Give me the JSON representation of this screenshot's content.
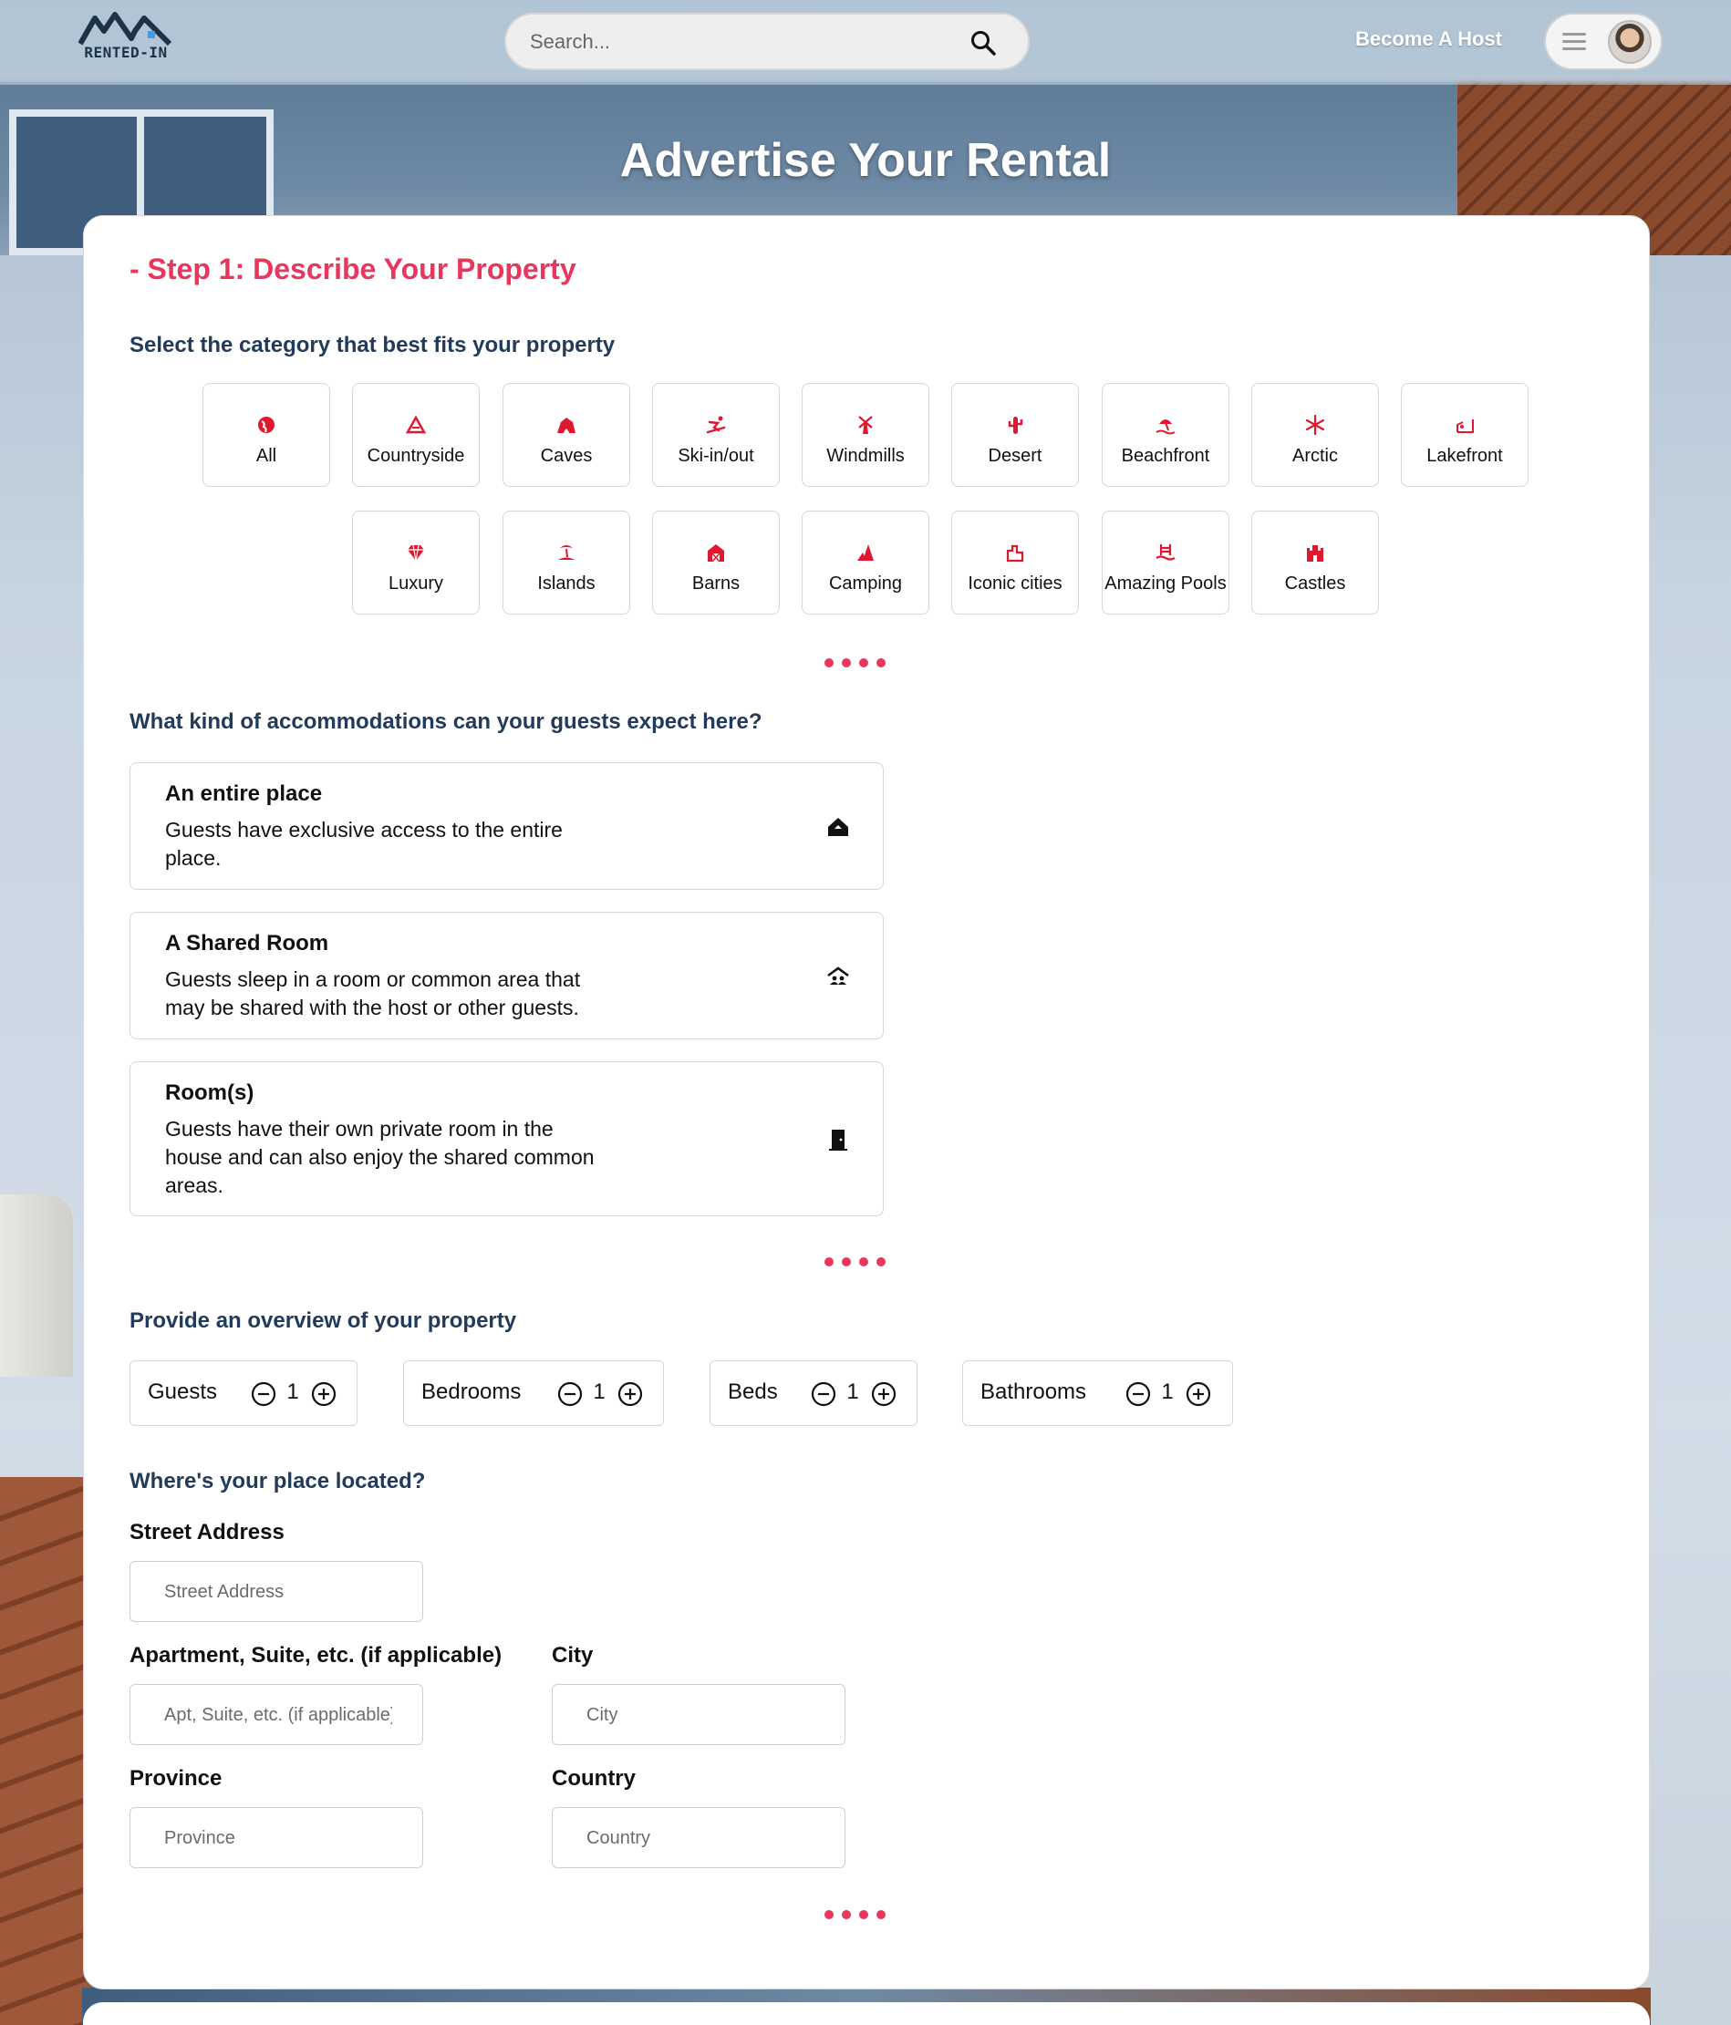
{
  "header": {
    "logo_text": "RENTED-IN",
    "search_placeholder": "Search...",
    "become_host_label": "Become A Host"
  },
  "hero": {
    "title": "Advertise Your Rental"
  },
  "form": {
    "step_title": "- Step 1: Describe Your Property",
    "category_question": "Select the category that best fits your property",
    "categories": [
      {
        "label": "All",
        "icon": "globe-icon"
      },
      {
        "label": "Countryside",
        "icon": "mountain-icon"
      },
      {
        "label": "Caves",
        "icon": "cave-icon"
      },
      {
        "label": "Ski-in/out",
        "icon": "skier-icon"
      },
      {
        "label": "Windmills",
        "icon": "windmill-icon"
      },
      {
        "label": "Desert",
        "icon": "cactus-icon"
      },
      {
        "label": "Beachfront",
        "icon": "beach-icon"
      },
      {
        "label": "Arctic",
        "icon": "snowflake-icon"
      },
      {
        "label": "Lakefront",
        "icon": "fishing-icon"
      },
      {
        "label": "Luxury",
        "icon": "diamond-icon"
      },
      {
        "label": "Islands",
        "icon": "island-icon"
      },
      {
        "label": "Barns",
        "icon": "barn-icon"
      },
      {
        "label": "Camping",
        "icon": "tent-icon"
      },
      {
        "label": "Iconic cities",
        "icon": "city-icon"
      },
      {
        "label": "Amazing Pools",
        "icon": "pool-icon"
      },
      {
        "label": "Castles",
        "icon": "castle-icon"
      }
    ],
    "accommodation_question": "What kind of accommodations can your guests expect here?",
    "accommodations": [
      {
        "title": "An entire place",
        "description": "Guests have exclusive access to the entire place.",
        "icon": "house-icon"
      },
      {
        "title": "A Shared Room",
        "description": "Guests sleep in a room or common area that may be shared with the host or other guests.",
        "icon": "shared-house-icon"
      },
      {
        "title": "Room(s)",
        "description": "Guests have their own private room in the house and can also enjoy the shared common areas.",
        "icon": "door-icon"
      }
    ],
    "overview_question": "Provide an overview of your property",
    "counters": [
      {
        "label": "Guests",
        "value": "1"
      },
      {
        "label": "Bedrooms",
        "value": "1"
      },
      {
        "label": "Beds",
        "value": "1"
      },
      {
        "label": "Bathrooms",
        "value": "1"
      }
    ],
    "location_question": "Where's your place located?",
    "fields": {
      "street_label": "Street Address",
      "street_placeholder": "Street Address",
      "apt_label": "Apartment, Suite, etc. (if applicable)",
      "apt_placeholder": "Apt, Suite, etc. (if applicable)",
      "city_label": "City",
      "city_placeholder": "City",
      "province_label": "Province",
      "province_placeholder": "Province",
      "country_label": "Country",
      "country_placeholder": "Country"
    }
  },
  "colors": {
    "accent": "#e8365d",
    "heading": "#223b5b",
    "icon_red": "#e0182f"
  }
}
